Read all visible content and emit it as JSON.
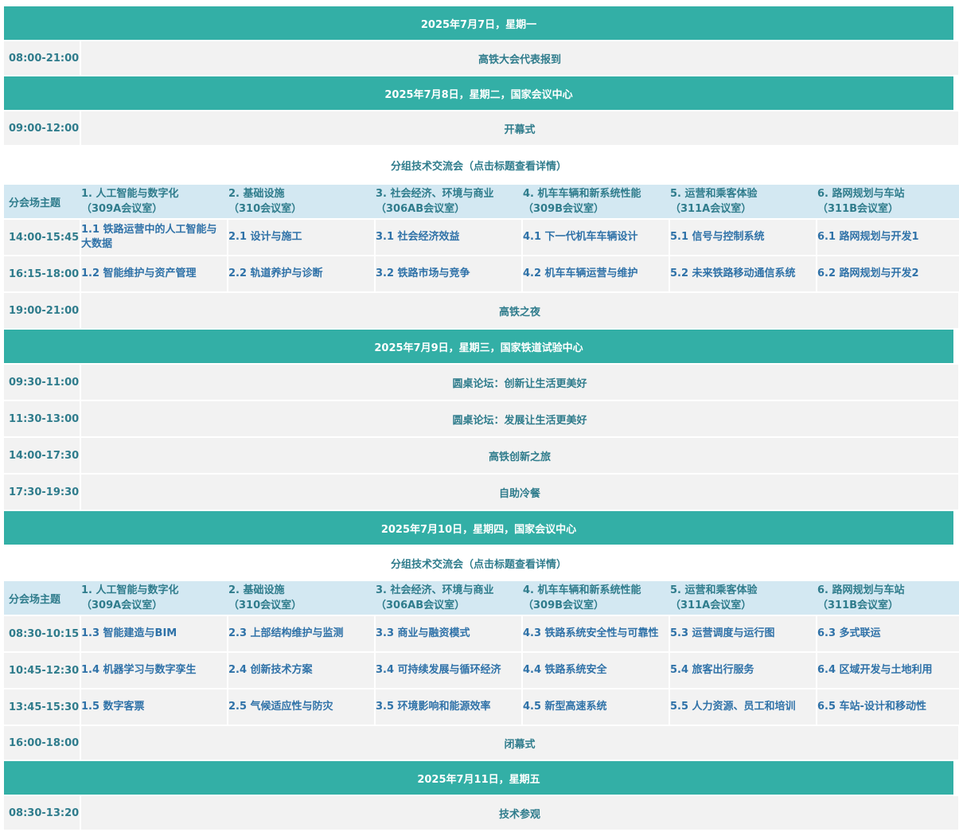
{
  "days": {
    "d1": {
      "header": "2025年7月7日，星期一",
      "r1": {
        "time": "08:00-21:00",
        "text": "高铁大会代表报到"
      }
    },
    "d2": {
      "header": "2025年7月8日，星期二，国家会议中心",
      "r1": {
        "time": "09:00-12:00",
        "text": "开幕式"
      },
      "subheading": "分组技术交流会（点击标题查看详情）",
      "r_night": {
        "time": "19:00-21:00",
        "text": "高铁之夜"
      }
    },
    "d3": {
      "header": "2025年7月9日，星期三，国家铁道试验中心",
      "r1": {
        "time": "09:30-11:00",
        "text": "圆桌论坛：创新让生活更美好"
      },
      "r2": {
        "time": "11:30-13:00",
        "text": "圆桌论坛：发展让生活更美好"
      },
      "r3": {
        "time": "14:00-17:30",
        "text": "高铁创新之旅"
      },
      "r4": {
        "time": "17:30-19:30",
        "text": "自助冷餐"
      }
    },
    "d4": {
      "header": "2025年7月10日，星期四，国家会议中心",
      "subheading": "分组技术交流会（点击标题查看详情）",
      "r_close": {
        "time": "16:00-18:00",
        "text": "闭幕式"
      }
    },
    "d5": {
      "header": "2025年7月11日，星期五",
      "r1": {
        "time": "08:30-13:20",
        "text": "技术参观"
      }
    }
  },
  "theme_header": {
    "label": "分会场主题",
    "themes": [
      {
        "name": "1. 人工智能与数字化",
        "room": "（309A会议室）"
      },
      {
        "name": "2. 基础设施",
        "room": "（310会议室）"
      },
      {
        "name": "3. 社会经济、环境与商业",
        "room": "（306AB会议室）"
      },
      {
        "name": "4. 机车车辆和新系统性能",
        "room": "（309B会议室）"
      },
      {
        "name": "5. 运营和乘客体验",
        "room": "（311A会议室）"
      },
      {
        "name": "6. 路网规划与车站",
        "room": "（311B会议室）"
      }
    ]
  },
  "sessions_d2": [
    {
      "time": "14:00-15:45",
      "cells": [
        "1.1 铁路运营中的人工智能与大数据",
        "2.1 设计与施工",
        "3.1 社会经济效益",
        "4.1 下一代机车车辆设计",
        "5.1 信号与控制系统",
        "6.1 路网规划与开发1"
      ]
    },
    {
      "time": "16:15-18:00",
      "cells": [
        "1.2 智能维护与资产管理",
        "2.2 轨道养护与诊断",
        "3.2 铁路市场与竞争",
        "4.2 机车车辆运营与维护",
        "5.2 未来铁路移动通信系统",
        "6.2 路网规划与开发2"
      ]
    }
  ],
  "sessions_d4": [
    {
      "time": "08:30-10:15",
      "cells": [
        "1.3 智能建造与BIM",
        "2.3 上部结构维护与监测",
        "3.3 商业与融资模式",
        "4.3 铁路系统安全性与可靠性",
        "5.3 运营调度与运行图",
        "6.3 多式联运"
      ]
    },
    {
      "time": "10:45-12:30",
      "cells": [
        "1.4 机器学习与数字孪生",
        "2.4 创新技术方案",
        "3.4 可持续发展与循环经济",
        "4.4 铁路系统安全",
        "5.4 旅客出行服务",
        "6.4 区域开发与土地利用"
      ]
    },
    {
      "time": "13:45-15:30",
      "cells": [
        "1.5 数字客票",
        "2.5 气候适应性与防灾",
        "3.5 环境影响和能源效率",
        "4.5 新型高速系统",
        "5.5 人力资源、员工和培训",
        "6.5 车站-设计和移动性"
      ]
    }
  ]
}
